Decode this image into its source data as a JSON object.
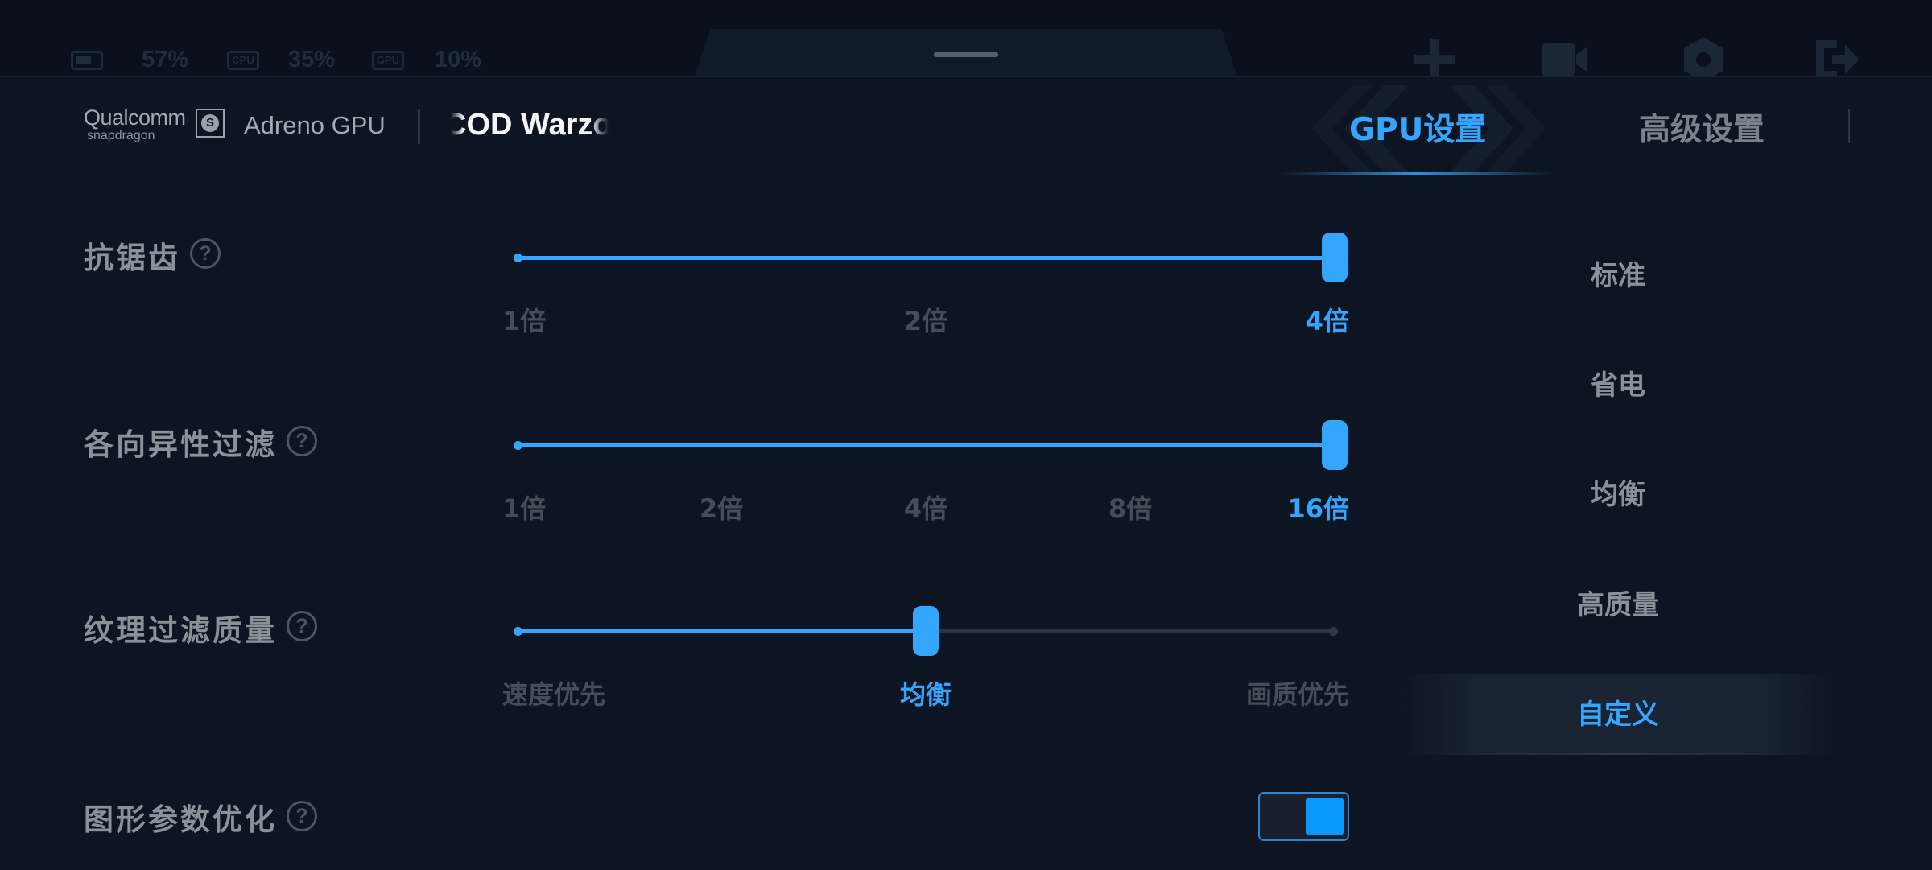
{
  "status_bar": {
    "battery": "57%",
    "cpu_icon": "CPU",
    "cpu": "35%",
    "gpu_icon": "GPU",
    "gpu": "10%"
  },
  "header": {
    "brand_top": "Qualcomm",
    "brand_bottom": "snapdragon",
    "gpu_name": "Adreno GPU",
    "game_name": "COD Warzone"
  },
  "tabs": [
    {
      "label": "GPU设置",
      "active": true
    },
    {
      "label": "高级设置",
      "active": false
    }
  ],
  "settings": {
    "anti_aliasing": {
      "label": "抗锯齿",
      "ticks": [
        "1倍",
        "2倍",
        "4倍"
      ],
      "selected": "4倍",
      "level": 1.0
    },
    "anisotropic": {
      "label": "各向异性过滤",
      "ticks": [
        "1倍",
        "2倍",
        "4倍",
        "8倍",
        "16倍"
      ],
      "selected": "16倍",
      "level": 1.0
    },
    "texture_quality": {
      "label": "纹理过滤质量",
      "ticks": [
        "速度优先",
        "均衡",
        "画质优先"
      ],
      "selected": "均衡",
      "level": 0.5
    },
    "graphics_optimization": {
      "label": "图形参数优化",
      "enabled": true
    }
  },
  "presets": [
    {
      "label": "标准",
      "active": false
    },
    {
      "label": "省电",
      "active": false
    },
    {
      "label": "均衡",
      "active": false
    },
    {
      "label": "高质量",
      "active": false
    },
    {
      "label": "自定义",
      "active": true
    }
  ],
  "colors": {
    "accent": "#35a6ff",
    "background": "#0d1522",
    "label": "#8a9199",
    "inactive_tick": "#454d58"
  },
  "icons": [
    "battery-icon",
    "cpu-icon",
    "gpu-icon",
    "crosshair-icon",
    "record-icon",
    "settings-icon",
    "exit-icon",
    "help-icon",
    "snapdragon-icon"
  ]
}
